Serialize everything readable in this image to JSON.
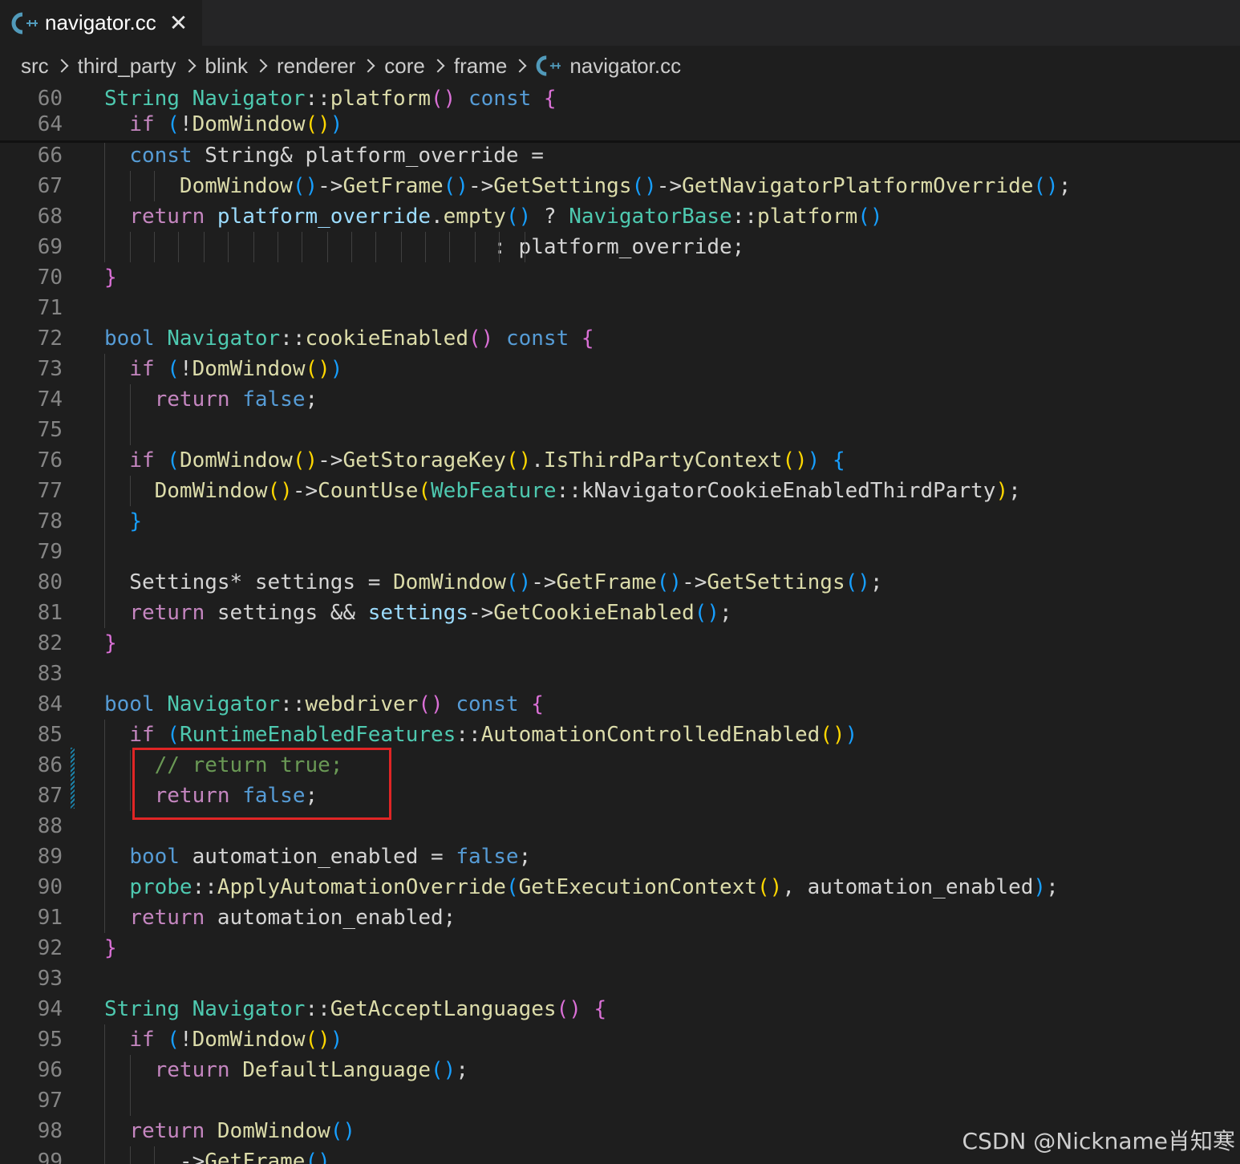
{
  "tab": {
    "label": "navigator.cc",
    "icon": "cpp-file-icon",
    "close_label": "✕"
  },
  "breadcrumb": [
    "src",
    "third_party",
    "blink",
    "renderer",
    "core",
    "frame",
    "navigator.cc"
  ],
  "colors": {
    "background": "#1e1e1e",
    "line_number": "#858585",
    "highlight_box": "#e02525",
    "keyword": "#569cd6",
    "control": "#c586c0",
    "type": "#4ec9b0",
    "function": "#dcdcaa",
    "variable": "#9cdcfe",
    "comment": "#6a9955"
  },
  "sticky": [
    {
      "n": "60",
      "tokens": [
        [
          "ty",
          "String"
        ],
        [
          "txt",
          " "
        ],
        [
          "ty",
          "Navigator"
        ],
        [
          "txt",
          "::"
        ],
        [
          "fn",
          "platform"
        ],
        [
          "b2",
          "()"
        ],
        [
          "txt",
          " "
        ],
        [
          "kw",
          "const"
        ],
        [
          "txt",
          " "
        ],
        [
          "b2",
          "{"
        ]
      ]
    },
    {
      "n": "64",
      "tokens": [
        [
          "txt",
          "  "
        ],
        [
          "ctrl",
          "if"
        ],
        [
          "txt",
          " "
        ],
        [
          "b3",
          "("
        ],
        [
          "txt",
          "!"
        ],
        [
          "fn",
          "DomWindow"
        ],
        [
          "b1",
          "()"
        ],
        [
          "b3",
          ")"
        ]
      ]
    }
  ],
  "lines": [
    {
      "n": "66",
      "tokens": [
        [
          "txt",
          "  "
        ],
        [
          "kw",
          "const"
        ],
        [
          "txt",
          " String& platform_override ="
        ]
      ]
    },
    {
      "n": "67",
      "tokens": [
        [
          "txt",
          "      "
        ],
        [
          "fn",
          "DomWindow"
        ],
        [
          "b3",
          "()"
        ],
        [
          "txt",
          "->"
        ],
        [
          "fn",
          "GetFrame"
        ],
        [
          "b3",
          "()"
        ],
        [
          "txt",
          "->"
        ],
        [
          "fn",
          "GetSettings"
        ],
        [
          "b3",
          "()"
        ],
        [
          "txt",
          "->"
        ],
        [
          "fn",
          "GetNavigatorPlatformOverride"
        ],
        [
          "b3",
          "()"
        ],
        [
          "txt",
          ";"
        ]
      ]
    },
    {
      "n": "68",
      "tokens": [
        [
          "txt",
          "  "
        ],
        [
          "ctrl",
          "return"
        ],
        [
          "txt",
          " "
        ],
        [
          "var",
          "platform_override"
        ],
        [
          "txt",
          "."
        ],
        [
          "fn",
          "empty"
        ],
        [
          "b3",
          "()"
        ],
        [
          "txt",
          " ? "
        ],
        [
          "ty",
          "NavigatorBase"
        ],
        [
          "txt",
          "::"
        ],
        [
          "fn",
          "platform"
        ],
        [
          "b3",
          "()"
        ]
      ]
    },
    {
      "n": "69",
      "tokens": [
        [
          "txt",
          "                               : platform_override;"
        ]
      ]
    },
    {
      "n": "70",
      "tokens": [
        [
          "b2",
          "}"
        ]
      ]
    },
    {
      "n": "71",
      "tokens": []
    },
    {
      "n": "72",
      "tokens": [
        [
          "kw",
          "bool"
        ],
        [
          "txt",
          " "
        ],
        [
          "ty",
          "Navigator"
        ],
        [
          "txt",
          "::"
        ],
        [
          "fn",
          "cookieEnabled"
        ],
        [
          "b2",
          "()"
        ],
        [
          "txt",
          " "
        ],
        [
          "kw",
          "const"
        ],
        [
          "txt",
          " "
        ],
        [
          "b2",
          "{"
        ]
      ]
    },
    {
      "n": "73",
      "tokens": [
        [
          "txt",
          "  "
        ],
        [
          "ctrl",
          "if"
        ],
        [
          "txt",
          " "
        ],
        [
          "b3",
          "("
        ],
        [
          "txt",
          "!"
        ],
        [
          "fn",
          "DomWindow"
        ],
        [
          "b1",
          "()"
        ],
        [
          "b3",
          ")"
        ]
      ]
    },
    {
      "n": "74",
      "tokens": [
        [
          "txt",
          "    "
        ],
        [
          "ctrl",
          "return"
        ],
        [
          "txt",
          " "
        ],
        [
          "kw",
          "false"
        ],
        [
          "txt",
          ";"
        ]
      ]
    },
    {
      "n": "75",
      "tokens": []
    },
    {
      "n": "76",
      "tokens": [
        [
          "txt",
          "  "
        ],
        [
          "ctrl",
          "if"
        ],
        [
          "txt",
          " "
        ],
        [
          "b3",
          "("
        ],
        [
          "fn",
          "DomWindow"
        ],
        [
          "b1",
          "()"
        ],
        [
          "txt",
          "->"
        ],
        [
          "fn",
          "GetStorageKey"
        ],
        [
          "b1",
          "()"
        ],
        [
          "txt",
          "."
        ],
        [
          "fn",
          "IsThirdPartyContext"
        ],
        [
          "b1",
          "()"
        ],
        [
          "b3",
          ")"
        ],
        [
          "txt",
          " "
        ],
        [
          "b3",
          "{"
        ]
      ]
    },
    {
      "n": "77",
      "tokens": [
        [
          "txt",
          "    "
        ],
        [
          "fn",
          "DomWindow"
        ],
        [
          "b1",
          "()"
        ],
        [
          "txt",
          "->"
        ],
        [
          "fn",
          "CountUse"
        ],
        [
          "b1",
          "("
        ],
        [
          "ty",
          "WebFeature"
        ],
        [
          "txt",
          "::kNavigatorCookieEnabledThirdParty"
        ],
        [
          "b1",
          ")"
        ],
        [
          "txt",
          ";"
        ]
      ]
    },
    {
      "n": "78",
      "tokens": [
        [
          "txt",
          "  "
        ],
        [
          "b3",
          "}"
        ]
      ]
    },
    {
      "n": "79",
      "tokens": []
    },
    {
      "n": "80",
      "tokens": [
        [
          "txt",
          "  Settings* settings = "
        ],
        [
          "fn",
          "DomWindow"
        ],
        [
          "b3",
          "()"
        ],
        [
          "txt",
          "->"
        ],
        [
          "fn",
          "GetFrame"
        ],
        [
          "b3",
          "()"
        ],
        [
          "txt",
          "->"
        ],
        [
          "fn",
          "GetSettings"
        ],
        [
          "b3",
          "()"
        ],
        [
          "txt",
          ";"
        ]
      ]
    },
    {
      "n": "81",
      "tokens": [
        [
          "txt",
          "  "
        ],
        [
          "ctrl",
          "return"
        ],
        [
          "txt",
          " settings && "
        ],
        [
          "var",
          "settings"
        ],
        [
          "txt",
          "->"
        ],
        [
          "fn",
          "GetCookieEnabled"
        ],
        [
          "b3",
          "()"
        ],
        [
          "txt",
          ";"
        ]
      ]
    },
    {
      "n": "82",
      "tokens": [
        [
          "b2",
          "}"
        ]
      ]
    },
    {
      "n": "83",
      "tokens": []
    },
    {
      "n": "84",
      "tokens": [
        [
          "kw",
          "bool"
        ],
        [
          "txt",
          " "
        ],
        [
          "ty",
          "Navigator"
        ],
        [
          "txt",
          "::"
        ],
        [
          "fn",
          "webdriver"
        ],
        [
          "b2",
          "()"
        ],
        [
          "txt",
          " "
        ],
        [
          "kw",
          "const"
        ],
        [
          "txt",
          " "
        ],
        [
          "b2",
          "{"
        ]
      ]
    },
    {
      "n": "85",
      "tokens": [
        [
          "txt",
          "  "
        ],
        [
          "ctrl",
          "if"
        ],
        [
          "txt",
          " "
        ],
        [
          "b3",
          "("
        ],
        [
          "ty",
          "RuntimeEnabledFeatures"
        ],
        [
          "txt",
          "::"
        ],
        [
          "fn",
          "AutomationControlledEnabled"
        ],
        [
          "b1",
          "()"
        ],
        [
          "b3",
          ")"
        ]
      ]
    },
    {
      "n": "86",
      "tokens": [
        [
          "txt",
          "    "
        ],
        [
          "cm",
          "// return true;"
        ]
      ]
    },
    {
      "n": "87",
      "tokens": [
        [
          "txt",
          "    "
        ],
        [
          "ctrl",
          "return"
        ],
        [
          "txt",
          " "
        ],
        [
          "kw",
          "false"
        ],
        [
          "txt",
          ";"
        ]
      ]
    },
    {
      "n": "88",
      "tokens": []
    },
    {
      "n": "89",
      "tokens": [
        [
          "txt",
          "  "
        ],
        [
          "kw",
          "bool"
        ],
        [
          "txt",
          " automation_enabled = "
        ],
        [
          "kw",
          "false"
        ],
        [
          "txt",
          ";"
        ]
      ]
    },
    {
      "n": "90",
      "tokens": [
        [
          "txt",
          "  "
        ],
        [
          "ty",
          "probe"
        ],
        [
          "txt",
          "::"
        ],
        [
          "fn",
          "ApplyAutomationOverride"
        ],
        [
          "b3",
          "("
        ],
        [
          "fn",
          "GetExecutionContext"
        ],
        [
          "b1",
          "()"
        ],
        [
          "txt",
          ", automation_enabled"
        ],
        [
          "b3",
          ")"
        ],
        [
          "txt",
          ";"
        ]
      ]
    },
    {
      "n": "91",
      "tokens": [
        [
          "txt",
          "  "
        ],
        [
          "ctrl",
          "return"
        ],
        [
          "txt",
          " automation_enabled;"
        ]
      ]
    },
    {
      "n": "92",
      "tokens": [
        [
          "b2",
          "}"
        ]
      ]
    },
    {
      "n": "93",
      "tokens": []
    },
    {
      "n": "94",
      "tokens": [
        [
          "ty",
          "String"
        ],
        [
          "txt",
          " "
        ],
        [
          "ty",
          "Navigator"
        ],
        [
          "txt",
          "::"
        ],
        [
          "fn",
          "GetAcceptLanguages"
        ],
        [
          "b2",
          "()"
        ],
        [
          "txt",
          " "
        ],
        [
          "b2",
          "{"
        ]
      ]
    },
    {
      "n": "95",
      "tokens": [
        [
          "txt",
          "  "
        ],
        [
          "ctrl",
          "if"
        ],
        [
          "txt",
          " "
        ],
        [
          "b3",
          "("
        ],
        [
          "txt",
          "!"
        ],
        [
          "fn",
          "DomWindow"
        ],
        [
          "b1",
          "()"
        ],
        [
          "b3",
          ")"
        ]
      ]
    },
    {
      "n": "96",
      "tokens": [
        [
          "txt",
          "    "
        ],
        [
          "ctrl",
          "return"
        ],
        [
          "txt",
          " "
        ],
        [
          "fn",
          "DefaultLanguage"
        ],
        [
          "b3",
          "()"
        ],
        [
          "txt",
          ";"
        ]
      ]
    },
    {
      "n": "97",
      "tokens": []
    },
    {
      "n": "98",
      "tokens": [
        [
          "txt",
          "  "
        ],
        [
          "ctrl",
          "return"
        ],
        [
          "txt",
          " "
        ],
        [
          "fn",
          "DomWindow"
        ],
        [
          "b3",
          "()"
        ]
      ]
    },
    {
      "n": "99",
      "tokens": [
        [
          "txt",
          "      ->"
        ],
        [
          "fn",
          "GetFrame"
        ],
        [
          "b3",
          "()"
        ]
      ]
    }
  ],
  "watermark": "CSDN @Nickname肖知寒"
}
